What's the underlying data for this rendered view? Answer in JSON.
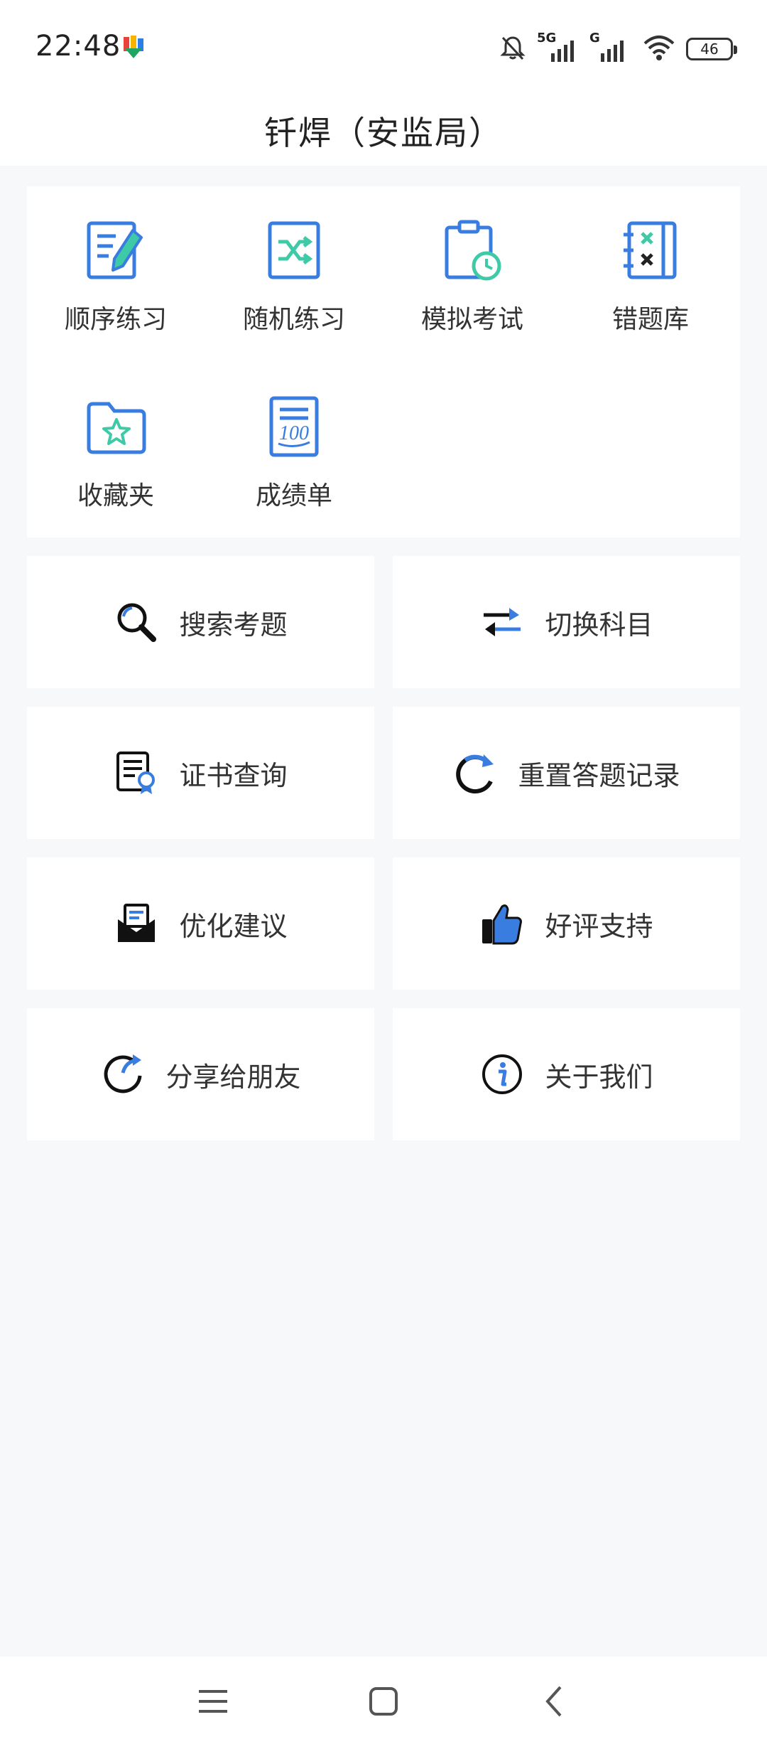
{
  "status": {
    "time": "22:48",
    "network_5g": "5G",
    "network_g": "G",
    "battery": "46"
  },
  "header": {
    "title": "钎焊（安监局）"
  },
  "grid": [
    {
      "label": "顺序练习",
      "icon": "edit-note-icon"
    },
    {
      "label": "随机练习",
      "icon": "shuffle-icon"
    },
    {
      "label": "模拟考试",
      "icon": "clipboard-clock-icon"
    },
    {
      "label": "错题库",
      "icon": "wrong-notebook-icon"
    },
    {
      "label": "收藏夹",
      "icon": "folder-star-icon"
    },
    {
      "label": "成绩单",
      "icon": "score-sheet-icon"
    }
  ],
  "actions": [
    {
      "label": "搜索考题",
      "icon": "search-icon"
    },
    {
      "label": "切换科目",
      "icon": "switch-arrows-icon"
    },
    {
      "label": "证书查询",
      "icon": "certificate-icon"
    },
    {
      "label": "重置答题记录",
      "icon": "reset-icon"
    },
    {
      "label": "优化建议",
      "icon": "mail-open-icon"
    },
    {
      "label": "好评支持",
      "icon": "thumbs-up-icon"
    },
    {
      "label": "分享给朋友",
      "icon": "share-icon"
    },
    {
      "label": "关于我们",
      "icon": "info-icon"
    }
  ],
  "colors": {
    "accent_blue": "#3a7de0",
    "accent_teal": "#3ec9a7",
    "background": "#f7f8fa"
  }
}
